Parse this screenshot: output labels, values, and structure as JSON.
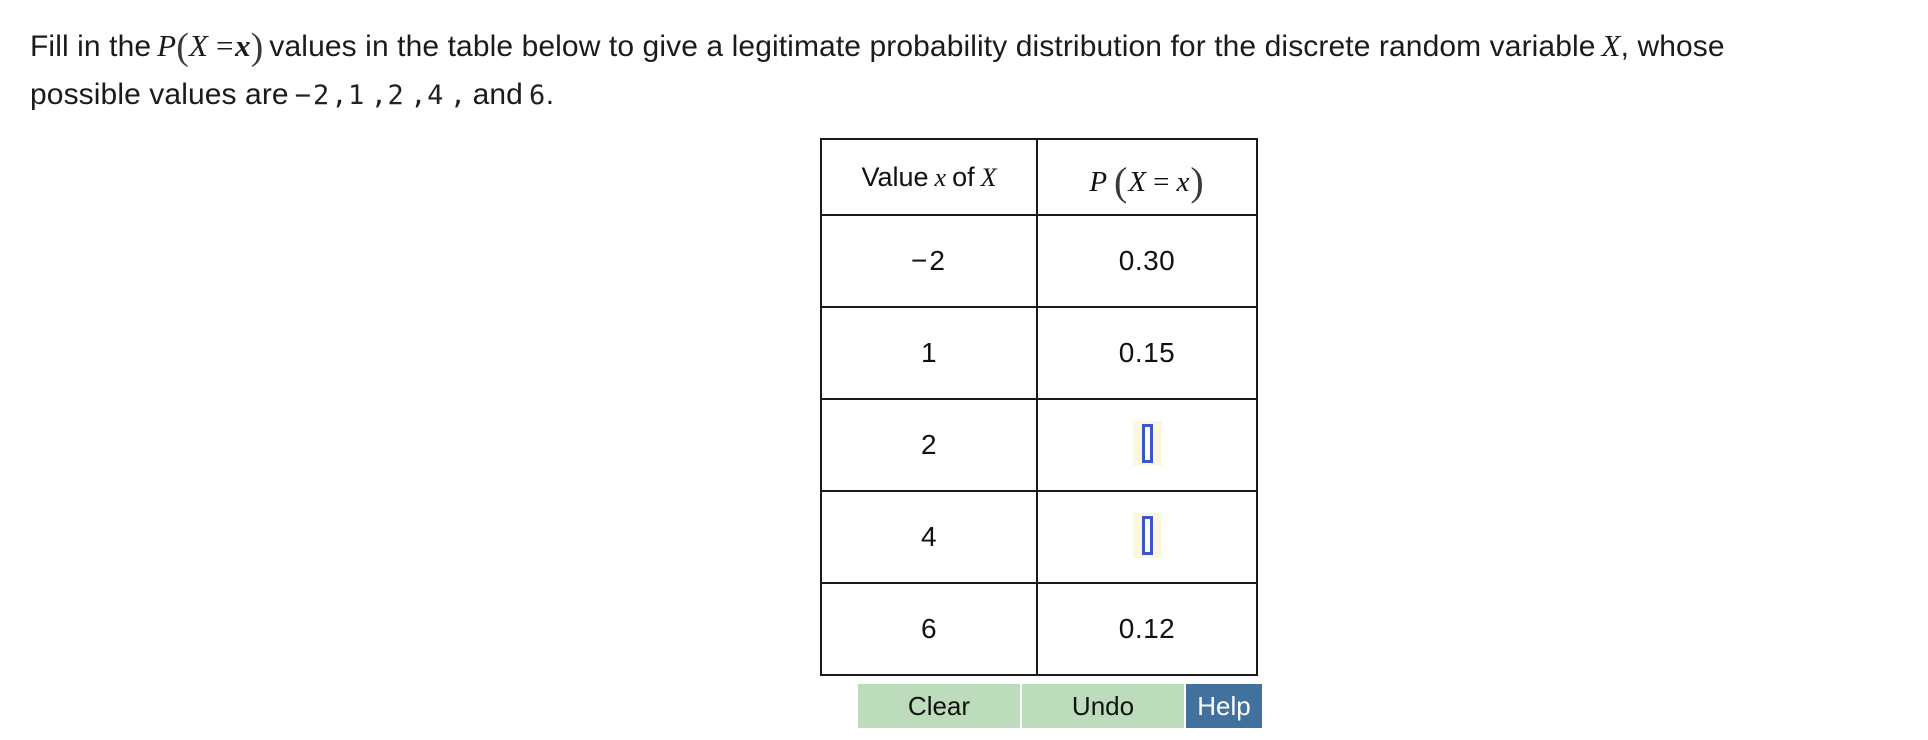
{
  "prompt": {
    "segment1": "Fill in the",
    "math_p_open": "P",
    "math_x_cap": "X",
    "math_eq": "=",
    "math_x_low": "x",
    "segment2": "values in the table below to give a legitimate probability distribution for the discrete random variable",
    "math_var": "X",
    "segment3": ", whose",
    "segment4": "possible values are",
    "values_list": [
      "−2",
      "1",
      "2",
      "4"
    ],
    "separator": ",",
    "segment5": "and",
    "last_value": "6",
    "period": "."
  },
  "table": {
    "header": {
      "col_value_prefix": "Value",
      "col_value_var": "x",
      "col_value_suffix": "of",
      "col_value_rv": "X",
      "col_prob_p": "P",
      "col_prob_open": "(",
      "col_prob_rv": "X",
      "col_prob_eq": "=",
      "col_prob_var": "x",
      "col_prob_close": ")"
    },
    "rows": [
      {
        "value": "−2",
        "probability": "0.30",
        "is_input": false
      },
      {
        "value": "1",
        "probability": "0.15",
        "is_input": false
      },
      {
        "value": "2",
        "probability": "",
        "is_input": true
      },
      {
        "value": "4",
        "probability": "",
        "is_input": true
      },
      {
        "value": "6",
        "probability": "0.12",
        "is_input": false
      }
    ]
  },
  "buttons": {
    "clear": "Clear",
    "undo": "Undo",
    "help": "Help"
  },
  "colors": {
    "button_green": "#bcdcbc",
    "button_help_blue": "#41719c",
    "input_border_blue": "#3a57cc",
    "input_highlight": "#fdf7dd",
    "table_border": "#1a1a1a"
  }
}
